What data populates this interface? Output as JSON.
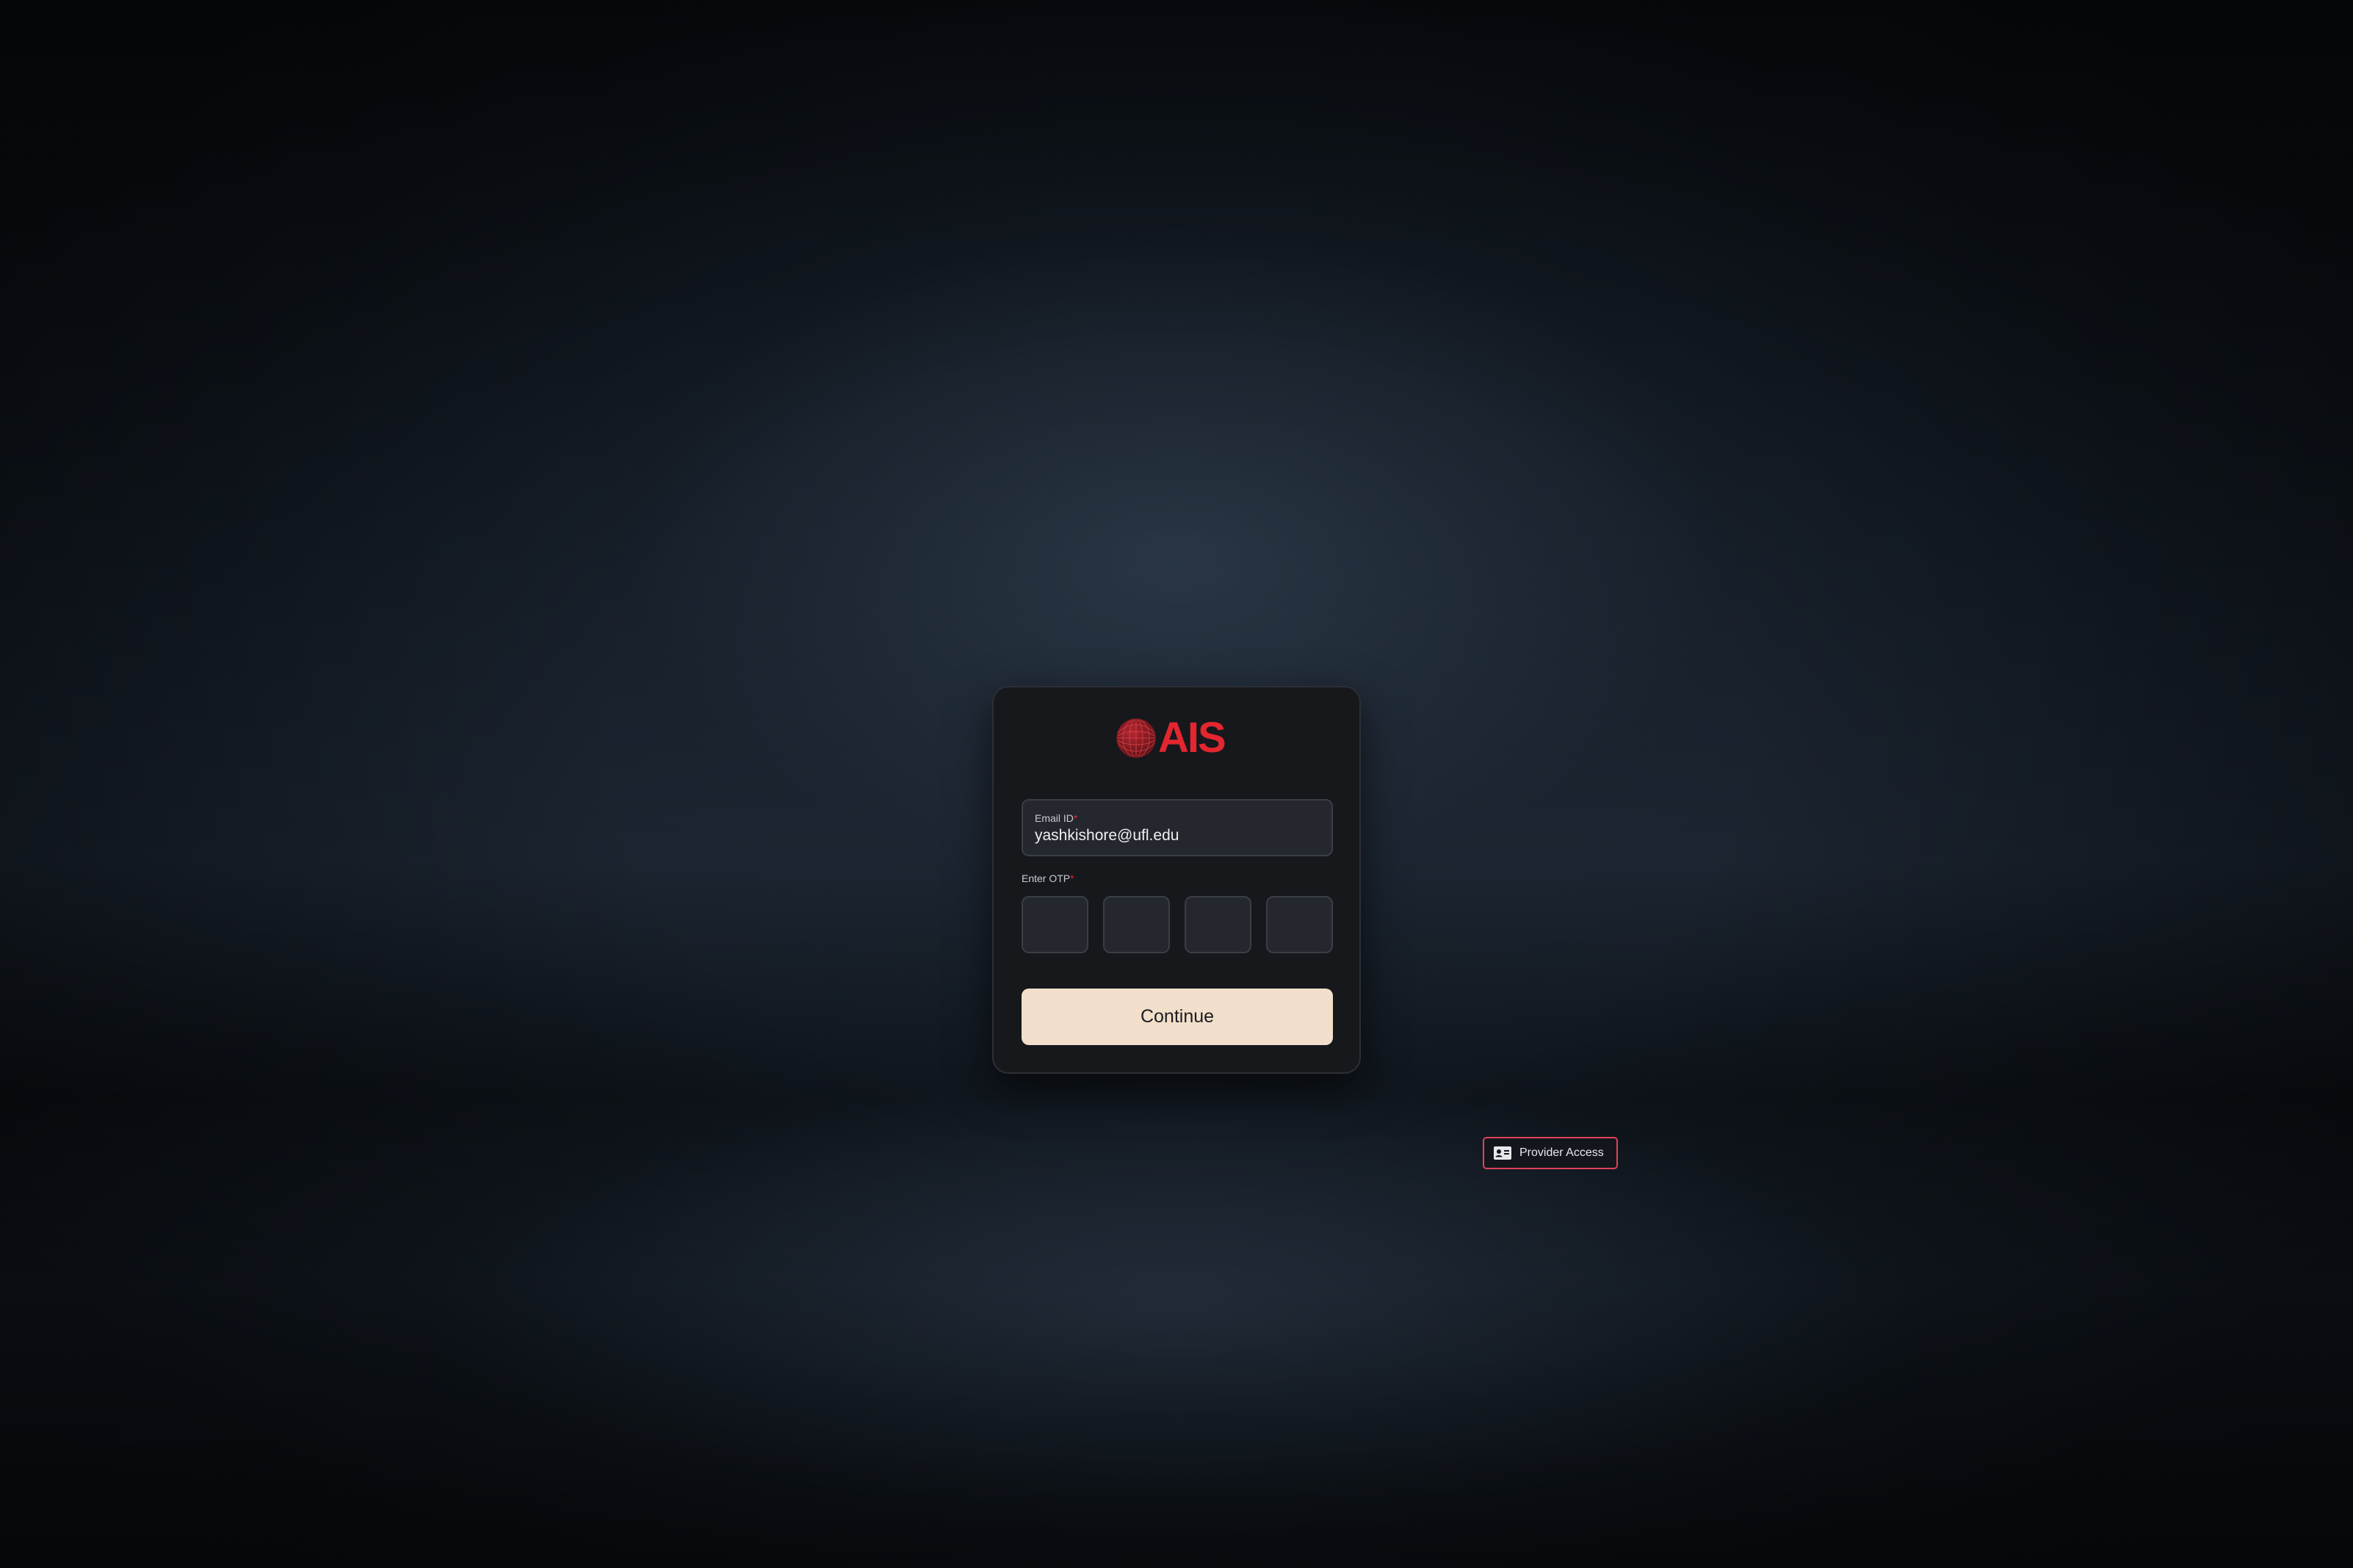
{
  "brand": {
    "logo_text": "AIS",
    "logo_icon": "globe-icon",
    "accent_color": "#e3262f"
  },
  "login_form": {
    "email": {
      "label": "Email ID",
      "required_mark": "*",
      "value": "yashkishore@ufl.edu"
    },
    "otp": {
      "label": "Enter OTP",
      "required_mark": "*",
      "digits": [
        "",
        "",
        "",
        ""
      ]
    },
    "continue_label": "Continue",
    "continue_color": "#f1dfcb"
  },
  "provider_access": {
    "label": "Provider Access",
    "icon": "id-card-icon",
    "border_color": "#e0425a"
  }
}
